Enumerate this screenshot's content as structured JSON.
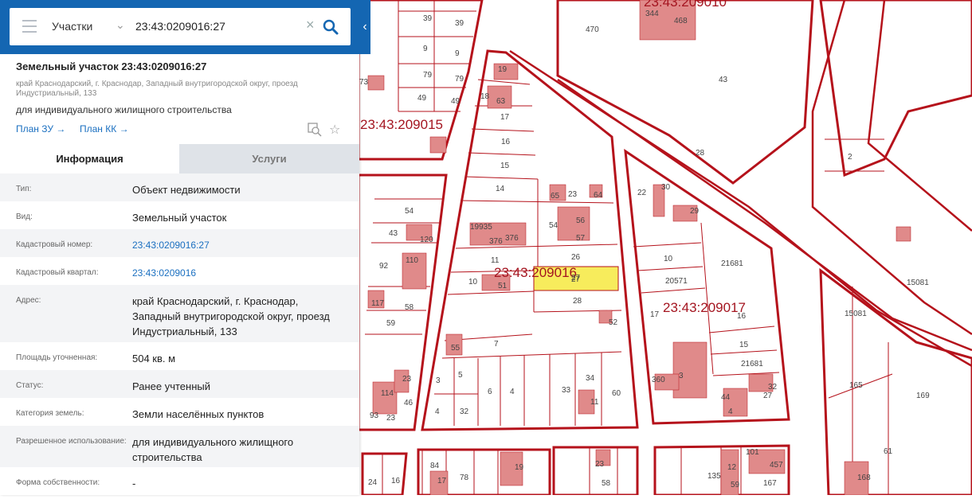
{
  "search": {
    "layer": "Участки",
    "value": "23:43:0209016:27"
  },
  "object": {
    "title": "Земельный участок 23:43:0209016:27",
    "address": "край Краснодарский, г. Краснодар, Западный внутригородской округ, проезд Индустриальный, 133",
    "purpose": "для индивидуального жилищного строительства",
    "plan_zu": "План ЗУ →",
    "plan_kk": "План КК →"
  },
  "tabs": {
    "info": "Информация",
    "services": "Услуги"
  },
  "info": [
    {
      "key": "Тип:",
      "value": "Объект недвижимости"
    },
    {
      "key": "Вид:",
      "value": "Земельный участок"
    },
    {
      "key": "Кадастровый номер:",
      "value": "23:43:0209016:27"
    },
    {
      "key": "Кадастровый квартал:",
      "value": "23:43:0209016"
    },
    {
      "key": "Адрес:",
      "value": "край Краснодарский, г. Краснодар, Западный внутригородской округ, проезд Индустриальный, 133"
    },
    {
      "key": "Площадь уточненная:",
      "value": "504 кв. м"
    },
    {
      "key": "Статус:",
      "value": "Ранее учтенный"
    },
    {
      "key": "Категория земель:",
      "value": "Земли населённых пунктов"
    },
    {
      "key": "Разрешенное использование:",
      "value": "для индивидуального жилищного строительства"
    },
    {
      "key": "Форма собственности:",
      "value": "-"
    }
  ],
  "map": {
    "quarters": [
      "23:43:209015",
      "23:43:209016",
      "23:43:209017",
      "23:43:209010"
    ],
    "selected_parcel": "27",
    "parcels": [
      "39",
      "39",
      "9",
      "9",
      "79",
      "79",
      "49",
      "49",
      "73",
      "19",
      "18",
      "63",
      "17",
      "16",
      "15",
      "14",
      "65",
      "23",
      "64",
      "22",
      "30",
      "29",
      "470",
      "344",
      "468",
      "43",
      "28",
      "2",
      "54",
      "43",
      "120",
      "92",
      "110",
      "19935",
      "376",
      "376",
      "54",
      "56",
      "57",
      "11",
      "26",
      "10",
      "51",
      "27",
      "28",
      "52",
      "117",
      "58",
      "59",
      "7",
      "55",
      "5",
      "3",
      "6",
      "4",
      "4",
      "32",
      "33",
      "34",
      "60",
      "11",
      "10",
      "20571",
      "21681",
      "17",
      "16",
      "15",
      "21681",
      "360",
      "3",
      "44",
      "4",
      "27",
      "32",
      "15081",
      "15081",
      "165",
      "169",
      "61",
      "93",
      "114",
      "23",
      "46",
      "23",
      "24",
      "16",
      "84",
      "17",
      "78",
      "19",
      "23",
      "58",
      "135",
      "12",
      "59",
      "101",
      "457",
      "167",
      "168"
    ],
    "colors": {
      "boundary": "#b5121b",
      "building": "#e08a8a",
      "selected": "#f7ec5c"
    }
  }
}
